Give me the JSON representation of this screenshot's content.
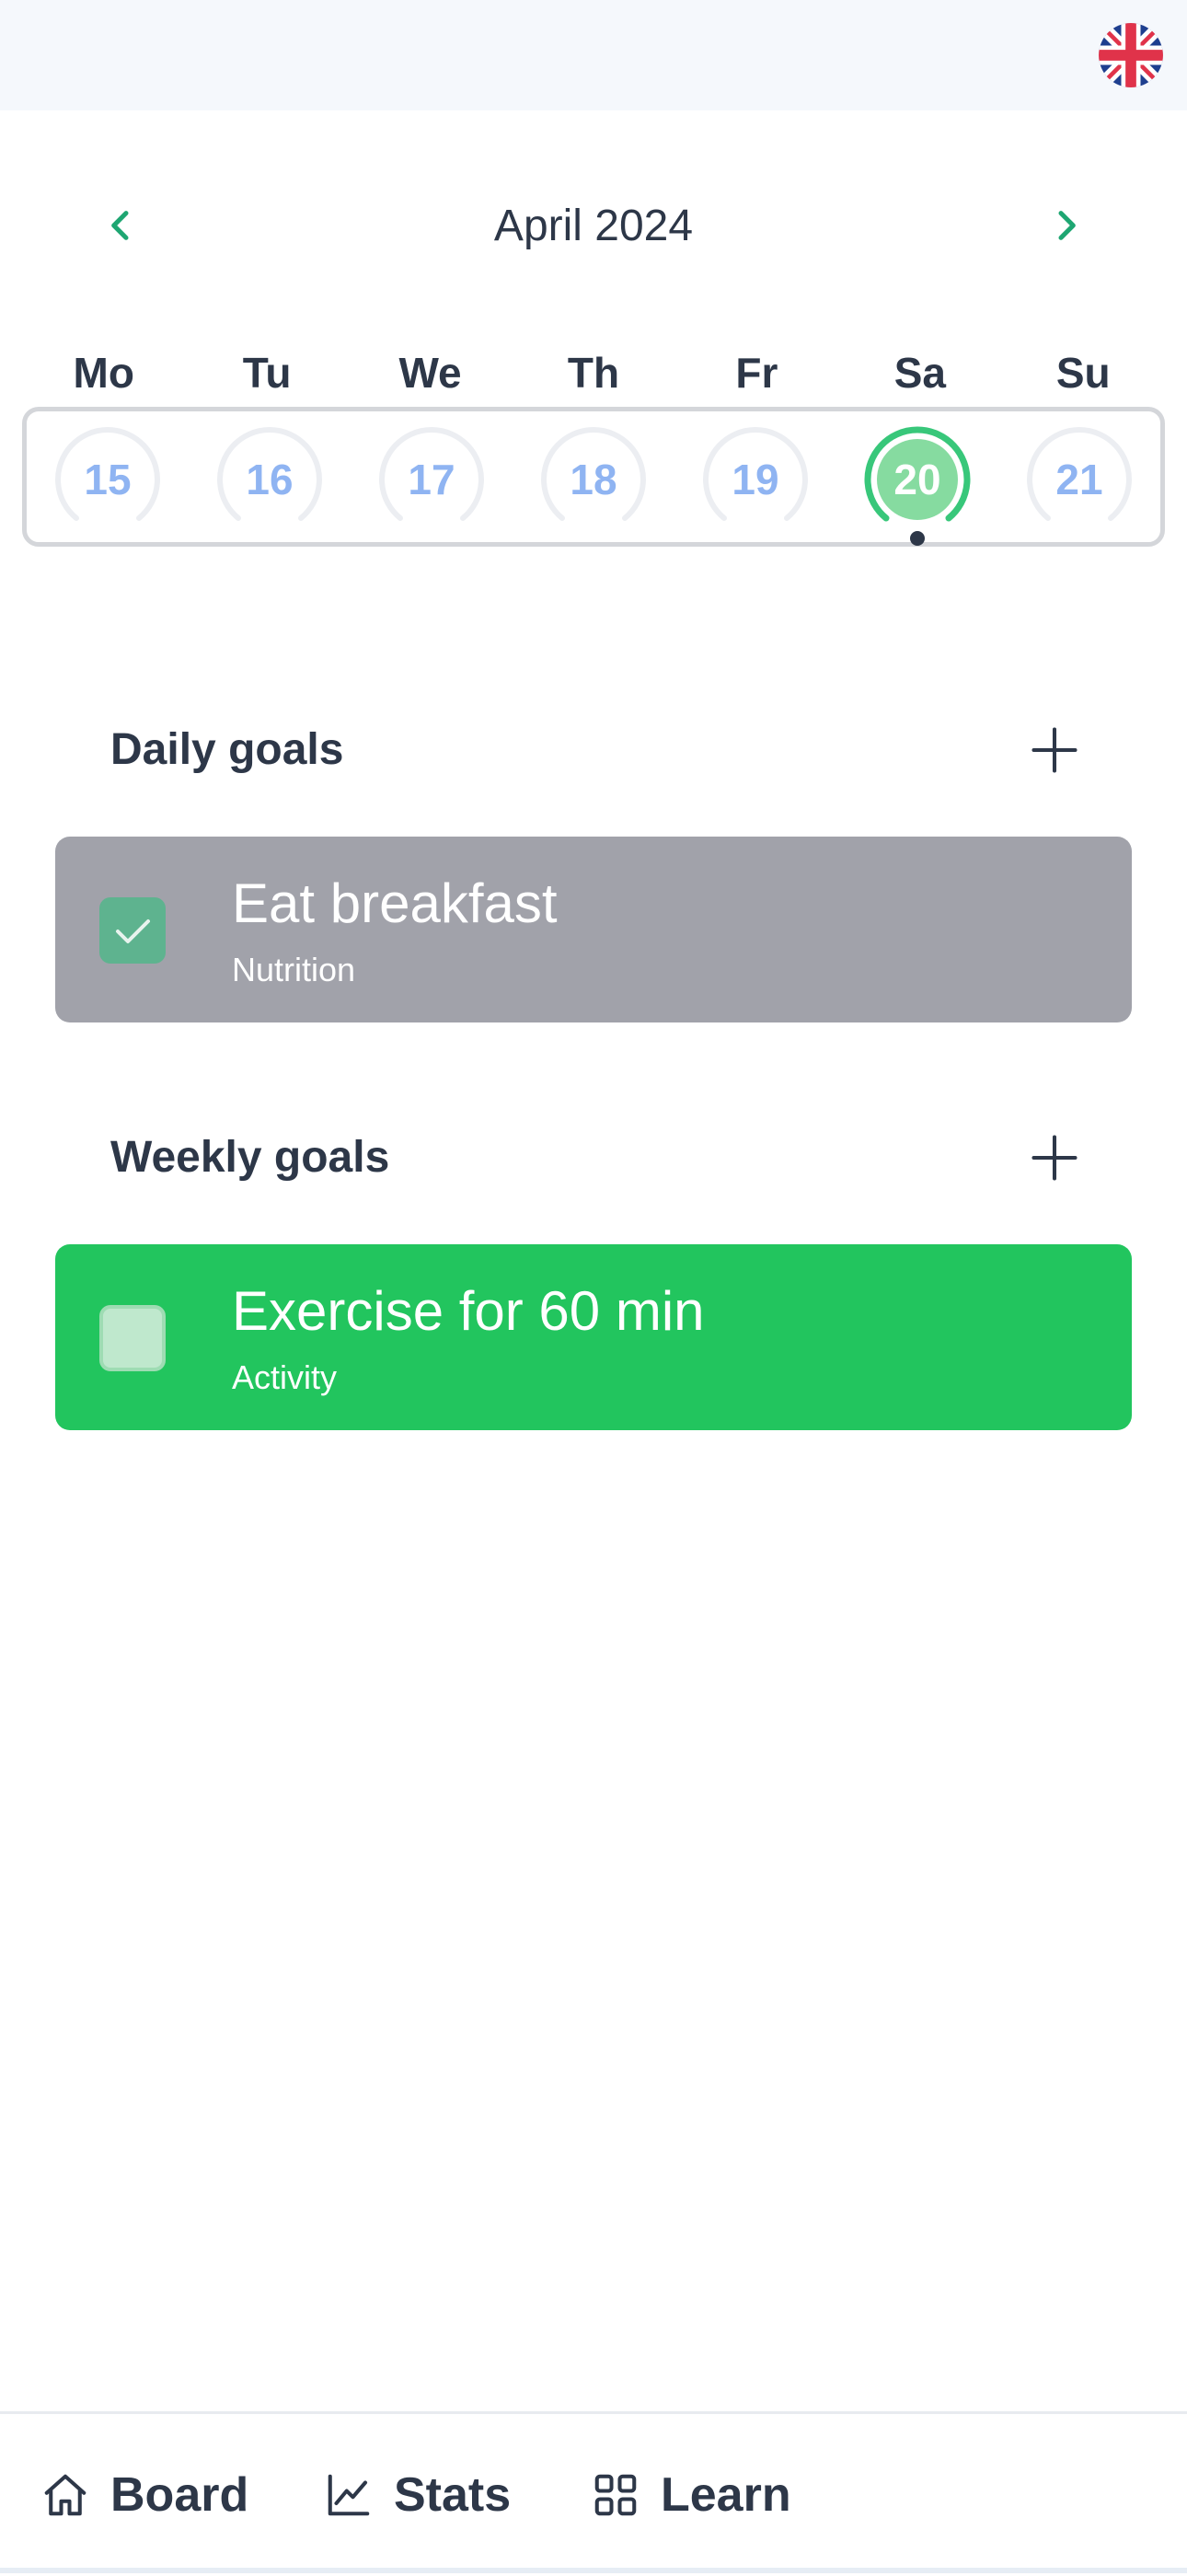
{
  "header": {
    "language_flag_icon": "uk-flag-icon"
  },
  "calendar": {
    "month_label": "April 2024",
    "prev_icon": "chevron-left-icon",
    "next_icon": "chevron-right-icon",
    "weekdays": [
      "Mo",
      "Tu",
      "We",
      "Th",
      "Fr",
      "Sa",
      "Su"
    ],
    "days": [
      "15",
      "16",
      "17",
      "18",
      "19",
      "20",
      "21"
    ],
    "selected_day": "20",
    "accent_color": "#22c55e"
  },
  "daily": {
    "title": "Daily goals",
    "add_icon": "plus-icon",
    "goals": [
      {
        "title": "Eat breakfast",
        "category": "Nutrition",
        "completed": true
      }
    ]
  },
  "weekly": {
    "title": "Weekly goals",
    "add_icon": "plus-icon",
    "goals": [
      {
        "title": "Exercise for 60 min",
        "category": "Activity",
        "completed": false
      }
    ]
  },
  "bottom_nav": {
    "items": [
      {
        "label": "Board",
        "icon": "home-icon"
      },
      {
        "label": "Stats",
        "icon": "chart-line-icon"
      },
      {
        "label": "Learn",
        "icon": "grid-icon"
      }
    ]
  }
}
